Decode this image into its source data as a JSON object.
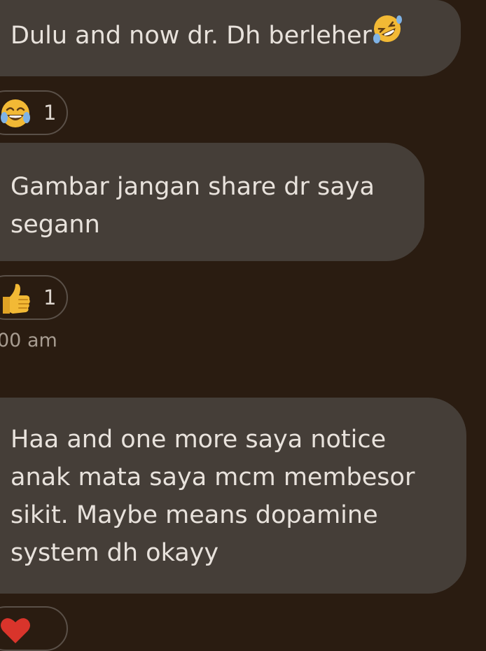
{
  "messages": [
    {
      "text": "Dulu and now dr. Dh berleher",
      "emoji": "rolling-on-floor-laughing-icon",
      "reaction": {
        "emoji": "face-with-tears-of-joy-icon",
        "count": "1"
      }
    },
    {
      "text_lines": [
        "Gambar jangan share dr saya",
        "segann"
      ],
      "reaction": {
        "emoji": "thumbs-up-icon",
        "count": "1"
      },
      "timestamp": "00 am"
    },
    {
      "text_lines": [
        "Haa and one more saya notice",
        "anak mata saya mcm membesor",
        "sikit. Maybe means dopamine",
        "system dh okayy"
      ]
    }
  ],
  "colors": {
    "background": "#2a1c11",
    "bubble": "#453e38",
    "text": "#e8e2dc",
    "timestamp": "#a79c91",
    "reaction_border": "#5a5048"
  }
}
